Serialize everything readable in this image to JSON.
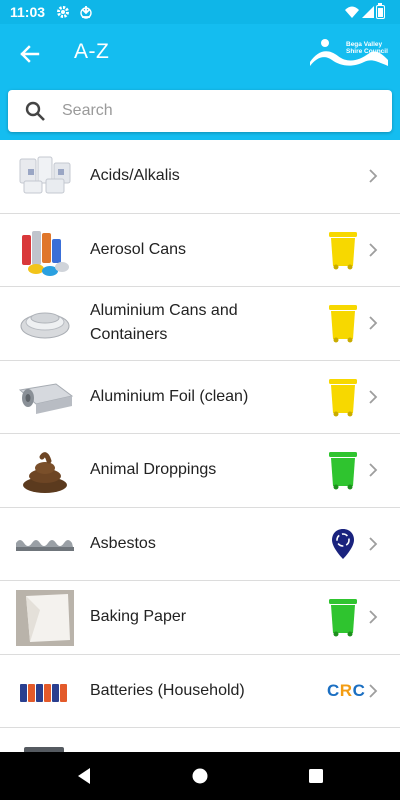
{
  "status_bar": {
    "time": "11:03",
    "icons": [
      "gear-icon",
      "download-icon",
      "wifi-icon",
      "signal-icon",
      "battery-icon"
    ]
  },
  "app_bar": {
    "title": "A-Z",
    "back_icon": "arrow-left-icon",
    "logo_text": "Bega Valley Shire Council"
  },
  "search": {
    "placeholder": "Search",
    "value": "",
    "icon": "search-icon"
  },
  "colors": {
    "header": "#14bdf0",
    "yellow_bin": "#f7d800",
    "green_bin": "#2fc42f",
    "pin": "#1a237e",
    "crc_blue": "#1b6fc2",
    "crc_orange": "#f39c12"
  },
  "items": [
    {
      "label": "Acids/Alkalis",
      "thumb": "chemical-drums",
      "indicator": "none"
    },
    {
      "label": "Aerosol Cans",
      "thumb": "aerosol-cans",
      "indicator": "yellow-bin"
    },
    {
      "label": "Aluminium Cans and Containers",
      "thumb": "aluminium-trays",
      "indicator": "yellow-bin"
    },
    {
      "label": "Aluminium Foil (clean)",
      "thumb": "foil-roll",
      "indicator": "yellow-bin"
    },
    {
      "label": "Animal Droppings",
      "thumb": "droppings",
      "indicator": "green-bin"
    },
    {
      "label": "Asbestos",
      "thumb": "asbestos-sheets",
      "indicator": "recycle-pin"
    },
    {
      "label": "Baking Paper",
      "thumb": "baking-paper",
      "indicator": "green-bin"
    },
    {
      "label": "Batteries (Household)",
      "thumb": "batteries",
      "indicator": "crc",
      "indicator_text": "CRC"
    }
  ],
  "nav_bar": {
    "buttons": [
      "back-triangle-icon",
      "home-circle-icon",
      "recents-square-icon"
    ]
  }
}
